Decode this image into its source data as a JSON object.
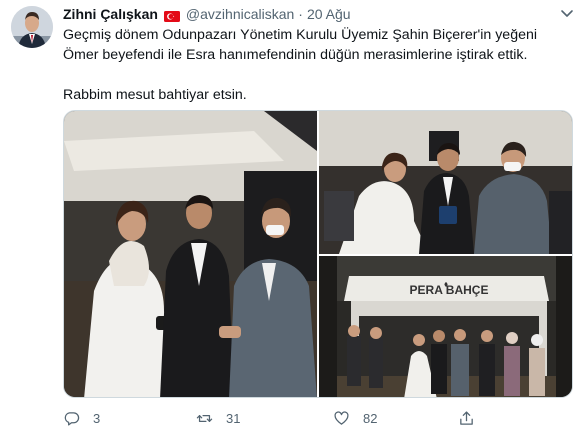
{
  "tweet": {
    "author_name": "Zihni Çalışkan",
    "handle": "@avzihnicaliskan",
    "separator": "·",
    "date": "20 Ağu",
    "text_line1": "Geçmiş dönem Odunpazarı Yönetim Kurulu Üyemiz Şahin Biçerer'in yeğeni",
    "text_line2": "Ömer beyefendi ile Esra hanımefendinin düğün merasimlerine iştirak ettik.",
    "text_line3": "Rabbim mesut bahtiyar etsin.",
    "photo_sign_text": "PERA♥BAHÇE",
    "photo_sign_display": "PERA   BAHÇE"
  },
  "actions": {
    "reply_count": "3",
    "retweet_count": "31",
    "like_count": "82"
  },
  "icons": {
    "flag": "turkey-flag-icon",
    "menu": "chevron-down-icon",
    "reply": "reply-icon",
    "retweet": "retweet-icon",
    "like": "heart-icon",
    "share": "share-icon"
  },
  "colors": {
    "text_primary": "#0f1419",
    "text_secondary": "#536471",
    "flag_red": "#e30a17"
  }
}
